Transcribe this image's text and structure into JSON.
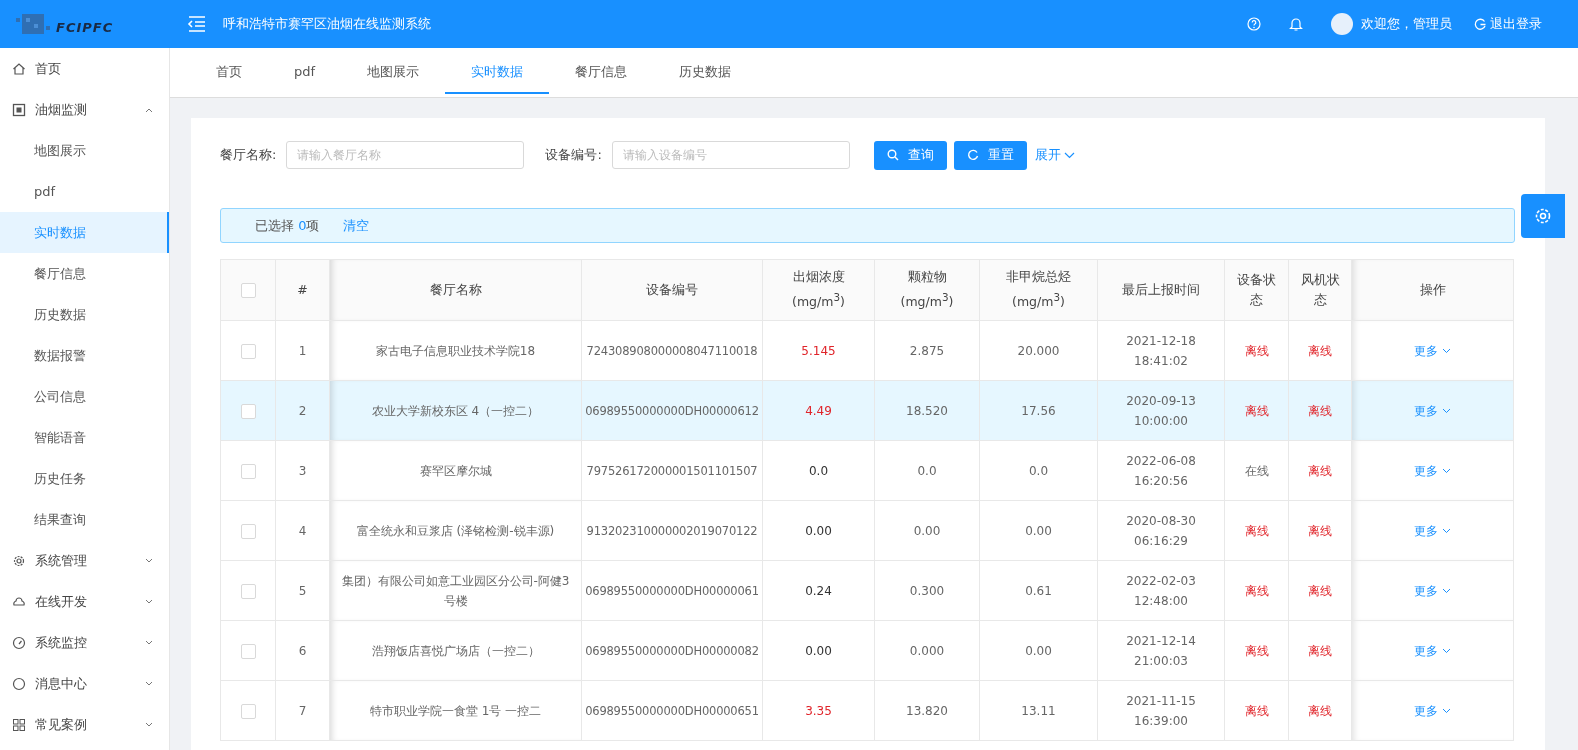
{
  "header": {
    "logo": "FCIPFC",
    "title": "呼和浩特市赛罕区油烟在线监测系统",
    "welcome": "欢迎您，管理员",
    "logout": "退出登录"
  },
  "sidebar": {
    "items": [
      {
        "label": "首页",
        "kind": "home",
        "selected": false
      },
      {
        "label": "油烟监测",
        "kind": "chip",
        "expanded": true,
        "children": [
          {
            "label": "地图展示",
            "selected": false
          },
          {
            "label": "pdf",
            "selected": false
          },
          {
            "label": "实时数据",
            "selected": true
          },
          {
            "label": "餐厅信息",
            "selected": false
          },
          {
            "label": "历史数据",
            "selected": false
          },
          {
            "label": "数据报警",
            "selected": false
          },
          {
            "label": "公司信息",
            "selected": false
          },
          {
            "label": "智能语音",
            "selected": false
          },
          {
            "label": "历史任务",
            "selected": false
          },
          {
            "label": "结果查询",
            "selected": false
          }
        ]
      },
      {
        "label": "系统管理",
        "kind": "gear",
        "expanded": false
      },
      {
        "label": "在线开发",
        "kind": "cloud",
        "expanded": false
      },
      {
        "label": "系统监控",
        "kind": "gauge",
        "expanded": false
      },
      {
        "label": "消息中心",
        "kind": "circle",
        "expanded": false
      },
      {
        "label": "常见案例",
        "kind": "grid",
        "expanded": false
      }
    ]
  },
  "tabs": [
    {
      "label": "首页",
      "selected": false
    },
    {
      "label": "pdf",
      "selected": false
    },
    {
      "label": "地图展示",
      "selected": false
    },
    {
      "label": "实时数据",
      "selected": true
    },
    {
      "label": "餐厅信息",
      "selected": false
    },
    {
      "label": "历史数据",
      "selected": false
    }
  ],
  "search": {
    "fields": [
      {
        "label": "餐厅名称:",
        "placeholder": "请输入餐厅名称"
      },
      {
        "label": "设备编号:",
        "placeholder": "请输入设备编号"
      }
    ],
    "query": "查询",
    "reset": "重置",
    "expand": "展开"
  },
  "selection": {
    "prefix": "已选择",
    "count": "0",
    "suffix": "项",
    "clear": "清空"
  },
  "table": {
    "select_all": false,
    "columns": [
      {
        "label": "#"
      },
      {
        "label": "餐厅名称"
      },
      {
        "label": "设备编号"
      },
      {
        "label": "出烟浓度",
        "unit": "(mg/m$^{3}$)"
      },
      {
        "label": "颗粒物",
        "unit": "(mg/m$^{3}$)"
      },
      {
        "label": "非甲烷总烃",
        "unit": "(mg/m$^{3}$)"
      },
      {
        "label": "最后上报时间"
      },
      {
        "label": "设备状态"
      },
      {
        "label": "风机状态"
      },
      {
        "label": "操作"
      }
    ],
    "rows": [
      {
        "checked": false,
        "highlighted": false,
        "index": "1",
        "name": "家古电子信息职业技术学院18",
        "device": "724308908000008047110018",
        "smoke": "5.145",
        "smoke_alarm": true,
        "particle": "2.875",
        "nmhc": "20.000",
        "date": "2021-12-18",
        "time": "18:41:02",
        "device_status": "离线",
        "device_online": false,
        "fan_status": "离线",
        "fan_online": false,
        "action": "更多"
      },
      {
        "checked": false,
        "highlighted": true,
        "index": "2",
        "name": "农业大学新校东区 4（一控二）",
        "device": "06989550000000DH00000612",
        "smoke": "4.49",
        "smoke_alarm": true,
        "particle": "18.520",
        "nmhc": "17.56",
        "date": "2020-09-13",
        "time": "10:00:00",
        "device_status": "离线",
        "device_online": false,
        "fan_status": "离线",
        "fan_online": false,
        "action": "更多"
      },
      {
        "checked": false,
        "highlighted": false,
        "index": "3",
        "name": "赛罕区摩尔城",
        "device": "797526172000001501101507",
        "smoke": "0.0",
        "smoke_alarm": false,
        "particle": "0.0",
        "nmhc": "0.0",
        "date": "2022-06-08",
        "time": "16:20:56",
        "device_status": "在线",
        "device_online": true,
        "fan_status": "离线",
        "fan_online": false,
        "action": "更多"
      },
      {
        "checked": false,
        "highlighted": false,
        "index": "4",
        "name": "富全统永和豆浆店 (泽铭检测-锐丰源)",
        "device": "913202310000002019070122",
        "smoke": "0.00",
        "smoke_alarm": false,
        "particle": "0.00",
        "nmhc": "0.00",
        "date": "2020-08-30",
        "time": "06:16:29",
        "device_status": "离线",
        "device_online": false,
        "fan_status": "离线",
        "fan_online": false,
        "action": "更多"
      },
      {
        "checked": false,
        "highlighted": false,
        "index": "5",
        "name": "集团）有限公司如意工业园区分公司-阿健3号楼",
        "device": "06989550000000DH00000061",
        "smoke": "0.24",
        "smoke_alarm": false,
        "particle": "0.300",
        "nmhc": "0.61",
        "date": "2022-02-03",
        "time": "12:48:00",
        "device_status": "离线",
        "device_online": false,
        "fan_status": "离线",
        "fan_online": false,
        "action": "更多"
      },
      {
        "checked": false,
        "highlighted": false,
        "index": "6",
        "name": "浩翔饭店喜悦广场店（一控二）",
        "device": "06989550000000DH00000082",
        "smoke": "0.00",
        "smoke_alarm": false,
        "particle": "0.000",
        "nmhc": "0.00",
        "date": "2021-12-14",
        "time": "21:00:03",
        "device_status": "离线",
        "device_online": false,
        "fan_status": "离线",
        "fan_online": false,
        "action": "更多"
      },
      {
        "checked": false,
        "highlighted": false,
        "index": "7",
        "name": "特市职业学院一食堂 1号 一控二",
        "device": "06989550000000DH00000651",
        "smoke": "3.35",
        "smoke_alarm": true,
        "particle": "13.820",
        "nmhc": "13.11",
        "date": "2021-11-15",
        "time": "16:39:00",
        "device_status": "离线",
        "device_online": false,
        "fan_status": "离线",
        "fan_online": false,
        "action": "更多"
      }
    ]
  }
}
